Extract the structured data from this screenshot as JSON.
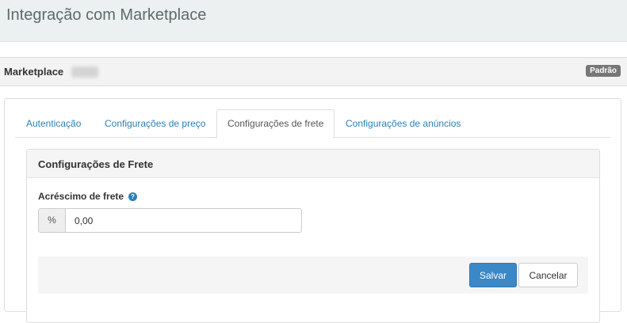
{
  "header": {
    "title": "Integração com Marketplace"
  },
  "marketplace": {
    "label": "Marketplace",
    "badge": "Padrão"
  },
  "tabs": [
    {
      "label": "Autenticação",
      "active": false
    },
    {
      "label": "Configurações de preço",
      "active": false
    },
    {
      "label": "Configurações de frete",
      "active": true
    },
    {
      "label": "Configurações de anúncios",
      "active": false
    }
  ],
  "section": {
    "title": "Configurações de Frete",
    "field": {
      "label": "Acréscimo de frete",
      "addon": "%",
      "value": "0,00",
      "help_icon": "question-circle-icon"
    }
  },
  "actions": {
    "save_label": "Salvar",
    "cancel_label": "Cancelar"
  },
  "colors": {
    "link": "#2a80b9",
    "primary": "#3a88c8",
    "badge": "#777777"
  }
}
